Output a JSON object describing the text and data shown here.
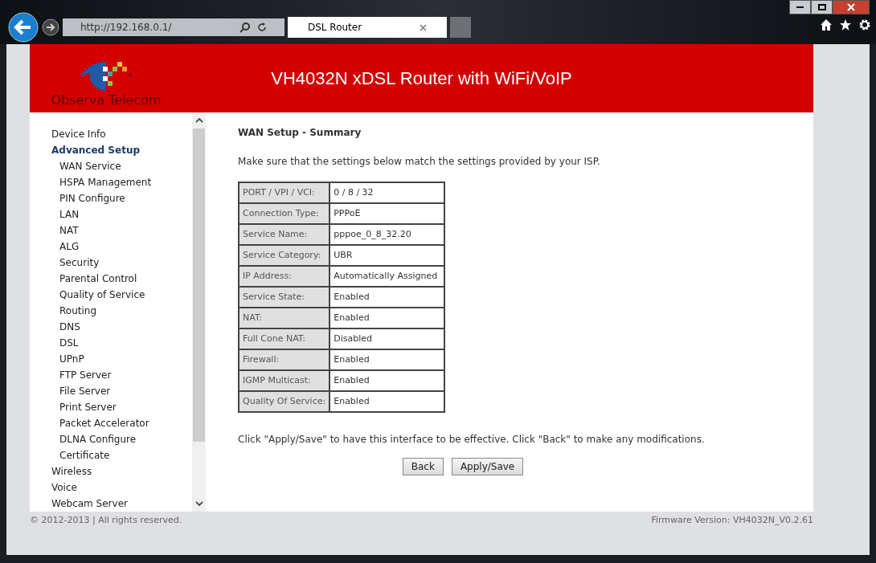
{
  "browser": {
    "address": "http://192.168.0.1/",
    "tab_title": "DSL Router"
  },
  "header": {
    "logo_text": "Observa Telecom",
    "title": "VH4032N xDSL Router with WiFi/VoIP"
  },
  "sidebar": {
    "items": [
      {
        "label": "Device Info",
        "selected": false
      },
      {
        "label": "Advanced Setup",
        "selected": true,
        "children": [
          {
            "label": "WAN Service",
            "selected": false
          },
          {
            "label": "HSPA Management",
            "selected": false
          },
          {
            "label": "PIN Configure",
            "selected": false
          },
          {
            "label": "LAN",
            "selected": false
          },
          {
            "label": "NAT",
            "selected": false
          },
          {
            "label": "ALG",
            "selected": false
          },
          {
            "label": "Security",
            "selected": false
          },
          {
            "label": "Parental Control",
            "selected": false
          },
          {
            "label": "Quality of Service",
            "selected": false
          },
          {
            "label": "Routing",
            "selected": false
          },
          {
            "label": "DNS",
            "selected": false
          },
          {
            "label": "DSL",
            "selected": false
          },
          {
            "label": "UPnP",
            "selected": false
          },
          {
            "label": "FTP Server",
            "selected": false
          },
          {
            "label": "File Server",
            "selected": false
          },
          {
            "label": "Print Server",
            "selected": false
          },
          {
            "label": "Packet Accelerator",
            "selected": false
          },
          {
            "label": "DLNA Configure",
            "selected": false
          },
          {
            "label": "Certificate",
            "selected": false
          }
        ]
      },
      {
        "label": "Wireless",
        "selected": false
      },
      {
        "label": "Voice",
        "selected": false
      },
      {
        "label": "Webcam Server",
        "selected": false
      }
    ]
  },
  "main": {
    "title": "WAN Setup - Summary",
    "intro": "Make sure that the settings below match the settings provided by your ISP.",
    "table": {
      "rows": [
        [
          "PORT / VPI / VCI:",
          "0 / 8 / 32"
        ],
        [
          "Connection Type:",
          "PPPoE"
        ],
        [
          "Service Name:",
          "pppoe_0_8_32.20"
        ],
        [
          "Service Category:",
          "UBR"
        ],
        [
          "IP Address:",
          "Automatically Assigned"
        ],
        [
          "Service State:",
          "Enabled"
        ],
        [
          "NAT:",
          "Enabled"
        ],
        [
          "Full Cone NAT:",
          "Disabled"
        ],
        [
          "Firewall:",
          "Enabled"
        ],
        [
          "IGMP Multicast:",
          "Enabled"
        ],
        [
          "Quality Of Service:",
          "Enabled"
        ]
      ]
    },
    "note": "Click \"Apply/Save\" to have this interface to be effective. Click \"Back\" to make any modifications.",
    "buttons": [
      "Back",
      "Apply/Save"
    ]
  },
  "footer": {
    "copyright": "© 2012-2013 | All rights reserved.",
    "firmware": "Firmware Version: VH4032N_V0.2.61"
  }
}
